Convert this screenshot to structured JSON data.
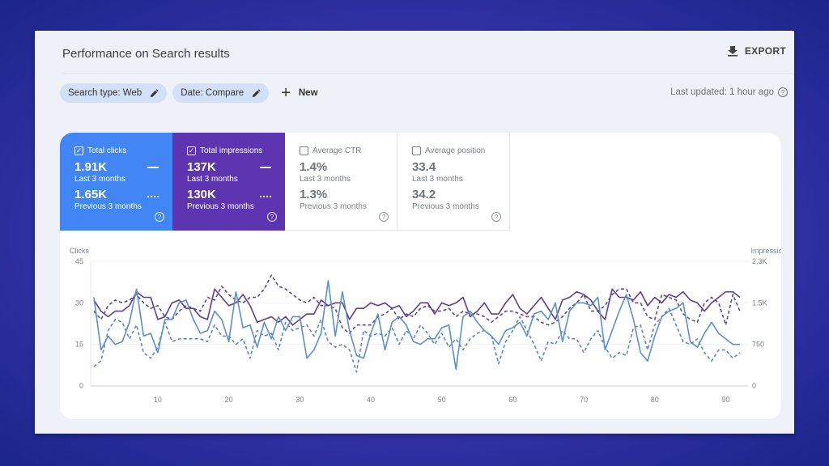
{
  "header": {
    "title": "Performance on Search results",
    "export_label": "EXPORT",
    "last_updated": "Last updated: 1 hour ago"
  },
  "filters": {
    "chips": [
      {
        "label": "Search type: Web"
      },
      {
        "label": "Date: Compare"
      }
    ],
    "new_label": "New"
  },
  "metrics": [
    {
      "key": "clicks",
      "label": "Total clicks",
      "checked": true,
      "current": "1.91K",
      "current_period": "Last 3 months",
      "previous": "1.65K",
      "previous_period": "Previous 3 months",
      "color": "#4285f4"
    },
    {
      "key": "impressions",
      "label": "Total impressions",
      "checked": true,
      "current": "137K",
      "current_period": "Last 3 months",
      "previous": "130K",
      "previous_period": "Previous 3 months",
      "color": "#5e35b1"
    },
    {
      "key": "ctr",
      "label": "Average CTR",
      "checked": false,
      "current": "1.4%",
      "current_period": "Last 3 months",
      "previous": "1.3%",
      "previous_period": "Previous 3 months"
    },
    {
      "key": "position",
      "label": "Average position",
      "checked": false,
      "current": "33.4",
      "current_period": "Last 3 months",
      "previous": "34.2",
      "previous_period": "Previous 3 months"
    }
  ],
  "colors": {
    "clicks": "#5b8fd0",
    "clicks_prev": "#5e86c4",
    "impressions": "#5c3f8f",
    "impressions_prev": "#5a4a92"
  },
  "chart_data": {
    "type": "line",
    "title": "",
    "xlabel": "",
    "ylabel_left": "Clicks",
    "ylabel_right": "Impressions",
    "x_ticks": [
      10,
      20,
      30,
      40,
      50,
      60,
      70,
      80,
      90
    ],
    "x_range": [
      1,
      92
    ],
    "y_left_ticks": [
      "0",
      "15",
      "30",
      "45"
    ],
    "y_left_range": [
      0,
      45
    ],
    "y_right_ticks": [
      "0",
      "750",
      "1.5K",
      "2.3K"
    ],
    "y_right_range": [
      0,
      2300
    ],
    "grid": true,
    "series": [
      {
        "name": "Clicks (Last 3 months)",
        "axis": "left",
        "style": "solid",
        "values": [
          32,
          13,
          18,
          15,
          16,
          23,
          35,
          18,
          19,
          12,
          24,
          24,
          30,
          31,
          24,
          19,
          20,
          27,
          24,
          16,
          34,
          21,
          22,
          14,
          23,
          17,
          25,
          20,
          25,
          25,
          10,
          13,
          19,
          38,
          18,
          34,
          20,
          11,
          10,
          19,
          26,
          13,
          23,
          25,
          22,
          16,
          15,
          17,
          17,
          21,
          22,
          6,
          25,
          27,
          23,
          20,
          18,
          15,
          20,
          21,
          23,
          18,
          26,
          27,
          24,
          30,
          16,
          27,
          30,
          30,
          29,
          32,
          13,
          20,
          27,
          33,
          24,
          12,
          9,
          18,
          25,
          27,
          28,
          30,
          16,
          14,
          19,
          23,
          19,
          17,
          15,
          15
        ]
      },
      {
        "name": "Clicks (Previous 3 months)",
        "axis": "left",
        "style": "dashed",
        "values": [
          7,
          9,
          20,
          24,
          23,
          17,
          22,
          12,
          10,
          14,
          23,
          16,
          17,
          17,
          17,
          17,
          16,
          22,
          18,
          18,
          15,
          17,
          10,
          20,
          18,
          19,
          13,
          23,
          20,
          21,
          22,
          18,
          24,
          16,
          14,
          15,
          13,
          5,
          20,
          18,
          19,
          18,
          21,
          15,
          20,
          17,
          22,
          19,
          15,
          19,
          14,
          17,
          13,
          17,
          19,
          20,
          18,
          8,
          16,
          20,
          25,
          20,
          15,
          9,
          16,
          15,
          20,
          17,
          17,
          12,
          17,
          20,
          14,
          10,
          12,
          11,
          21,
          22,
          13,
          22,
          25,
          28,
          22,
          16,
          15,
          17,
          12,
          9,
          13,
          13,
          10,
          12
        ]
      },
      {
        "name": "Impressions (Last 3 months)",
        "axis": "left",
        "style": "solid",
        "values": [
          31,
          27,
          25,
          27,
          27,
          29,
          34,
          32,
          32,
          24,
          25,
          30,
          31,
          28,
          28,
          25,
          24,
          35,
          32,
          29,
          30,
          33,
          29,
          23,
          24,
          25,
          23,
          25,
          22,
          24,
          26,
          26,
          31,
          29,
          30,
          30,
          24,
          28,
          28,
          30,
          29,
          30,
          28,
          29,
          25,
          27,
          30,
          30,
          26,
          30,
          29,
          30,
          32,
          25,
          27,
          30,
          26,
          26,
          30,
          33,
          28,
          26,
          29,
          32,
          28,
          24,
          31,
          32,
          34,
          33,
          31,
          27,
          24,
          35,
          32,
          32,
          31,
          34,
          29,
          32,
          30,
          33,
          32,
          34,
          31,
          30,
          27,
          30,
          32,
          34,
          34,
          32
        ]
      },
      {
        "name": "Impressions (Previous 3 months)",
        "axis": "left",
        "style": "dashed",
        "values": [
          27,
          24,
          29,
          31,
          30,
          31,
          33,
          30,
          28,
          29,
          25,
          24,
          27,
          29,
          28,
          27,
          32,
          31,
          36,
          33,
          31,
          30,
          32,
          32,
          35,
          40,
          36,
          35,
          33,
          31,
          30,
          32,
          29,
          29,
          28,
          21,
          19,
          22,
          22,
          22,
          25,
          26,
          28,
          24,
          26,
          25,
          28,
          29,
          27,
          27,
          28,
          25,
          27,
          26,
          26,
          25,
          23,
          25,
          27,
          27,
          26,
          25,
          25,
          23,
          22,
          23,
          25,
          28,
          30,
          33,
          27,
          27,
          29,
          33,
          35,
          35,
          30,
          30,
          25,
          24,
          33,
          32,
          31,
          26,
          24,
          23,
          30,
          32,
          30,
          22,
          33,
          27
        ]
      }
    ]
  }
}
